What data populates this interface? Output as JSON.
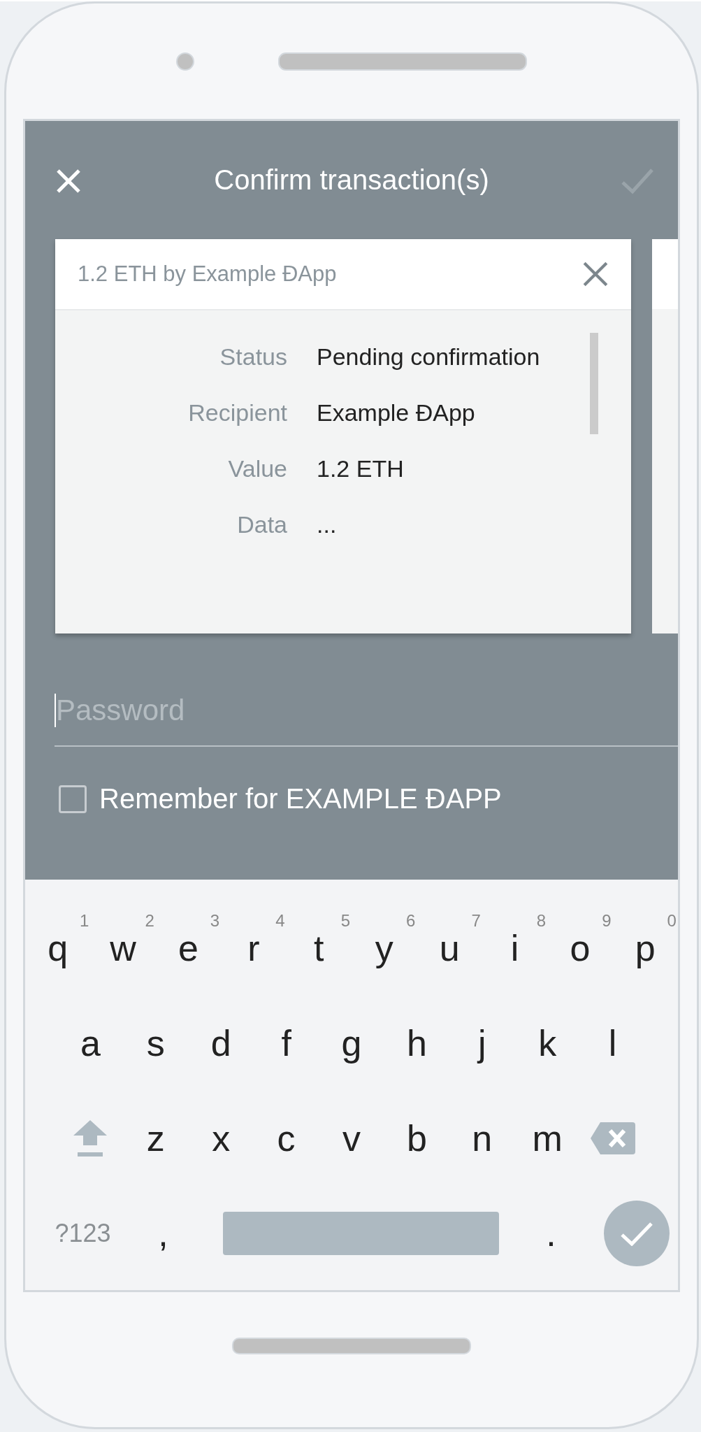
{
  "header": {
    "title": "Confirm transaction(s)",
    "confirm_disabled": true
  },
  "transaction_card": {
    "title": "1.2 ETH by Example ĐApp",
    "details": [
      {
        "label": "Status",
        "value": "Pending confirmation"
      },
      {
        "label": "Recipient",
        "value": "Example ĐApp"
      },
      {
        "label": "Value",
        "value": "1.2 ETH"
      },
      {
        "label": "Data",
        "value": "..."
      }
    ]
  },
  "password": {
    "placeholder": "Password"
  },
  "remember": {
    "label": "Remember for EXAMPLE ĐAPP",
    "checked": false
  },
  "keyboard": {
    "rows": [
      [
        {
          "kind": "letter",
          "label": "q",
          "hint": "1"
        },
        {
          "kind": "letter",
          "label": "w",
          "hint": "2"
        },
        {
          "kind": "letter",
          "label": "e",
          "hint": "3"
        },
        {
          "kind": "letter",
          "label": "r",
          "hint": "4"
        },
        {
          "kind": "letter",
          "label": "t",
          "hint": "5"
        },
        {
          "kind": "letter",
          "label": "y",
          "hint": "6"
        },
        {
          "kind": "letter",
          "label": "u",
          "hint": "7"
        },
        {
          "kind": "letter",
          "label": "i",
          "hint": "8"
        },
        {
          "kind": "letter",
          "label": "o",
          "hint": "9"
        },
        {
          "kind": "letter",
          "label": "p",
          "hint": "0"
        }
      ],
      [
        {
          "kind": "letter",
          "label": "a"
        },
        {
          "kind": "letter",
          "label": "s"
        },
        {
          "kind": "letter",
          "label": "d"
        },
        {
          "kind": "letter",
          "label": "f"
        },
        {
          "kind": "letter",
          "label": "g"
        },
        {
          "kind": "letter",
          "label": "h"
        },
        {
          "kind": "letter",
          "label": "j"
        },
        {
          "kind": "letter",
          "label": "k"
        },
        {
          "kind": "letter",
          "label": "l"
        }
      ],
      [
        {
          "kind": "shift"
        },
        {
          "kind": "letter",
          "label": "z"
        },
        {
          "kind": "letter",
          "label": "x"
        },
        {
          "kind": "letter",
          "label": "c"
        },
        {
          "kind": "letter",
          "label": "v"
        },
        {
          "kind": "letter",
          "label": "b"
        },
        {
          "kind": "letter",
          "label": "n"
        },
        {
          "kind": "letter",
          "label": "m"
        },
        {
          "kind": "backspace"
        }
      ]
    ],
    "bottom_row": {
      "symbols": "?123",
      "comma": ",",
      "period": "."
    }
  }
}
